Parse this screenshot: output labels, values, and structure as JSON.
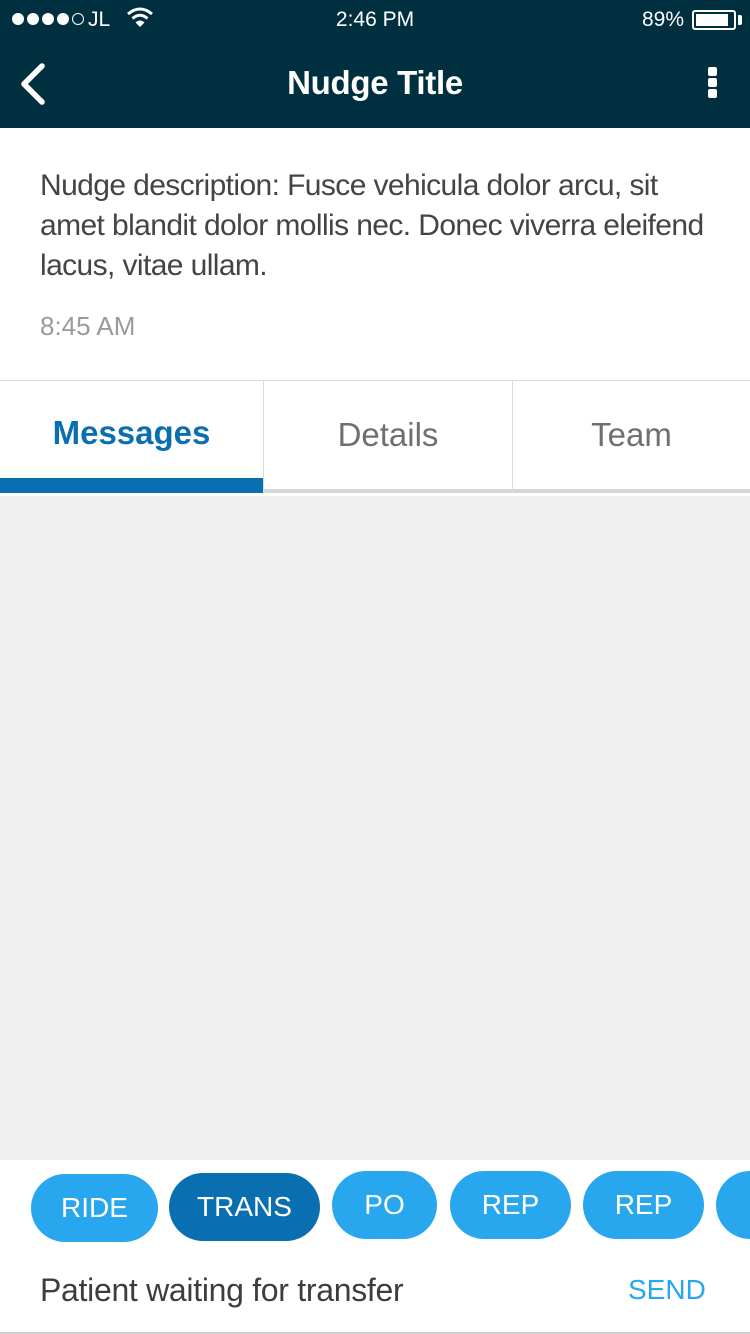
{
  "status_bar": {
    "carrier": "JL",
    "time": "2:46 PM",
    "battery_percent": "89%",
    "battery_level": 0.89
  },
  "header": {
    "title": "Nudge Title",
    "back_icon": "chevron-left-icon",
    "menu_icon": "more-vertical-icon",
    "background": "#00303f"
  },
  "nudge": {
    "description": "Nudge description: Fusce vehicula dolor arcu, sit amet blandit dolor mollis nec. Donec viverra eleifend lacus, vitae ullam.",
    "time": "8:45 AM"
  },
  "tabs": [
    {
      "label": "Messages",
      "active": true
    },
    {
      "label": "Details",
      "active": false
    },
    {
      "label": "Team",
      "active": false
    }
  ],
  "quick_replies": [
    {
      "label": "RIDE",
      "selected": false
    },
    {
      "label": "TRANS",
      "selected": true
    },
    {
      "label": "PO",
      "selected": false
    },
    {
      "label": "REP",
      "selected": false
    },
    {
      "label": "REP",
      "selected": false
    }
  ],
  "composer": {
    "message_text": "Patient waiting for transfer",
    "send_label": "SEND"
  },
  "colors": {
    "accent": "#0a6fb1",
    "chip": "#28a6ee",
    "chip_selected": "#0a6fb1"
  }
}
